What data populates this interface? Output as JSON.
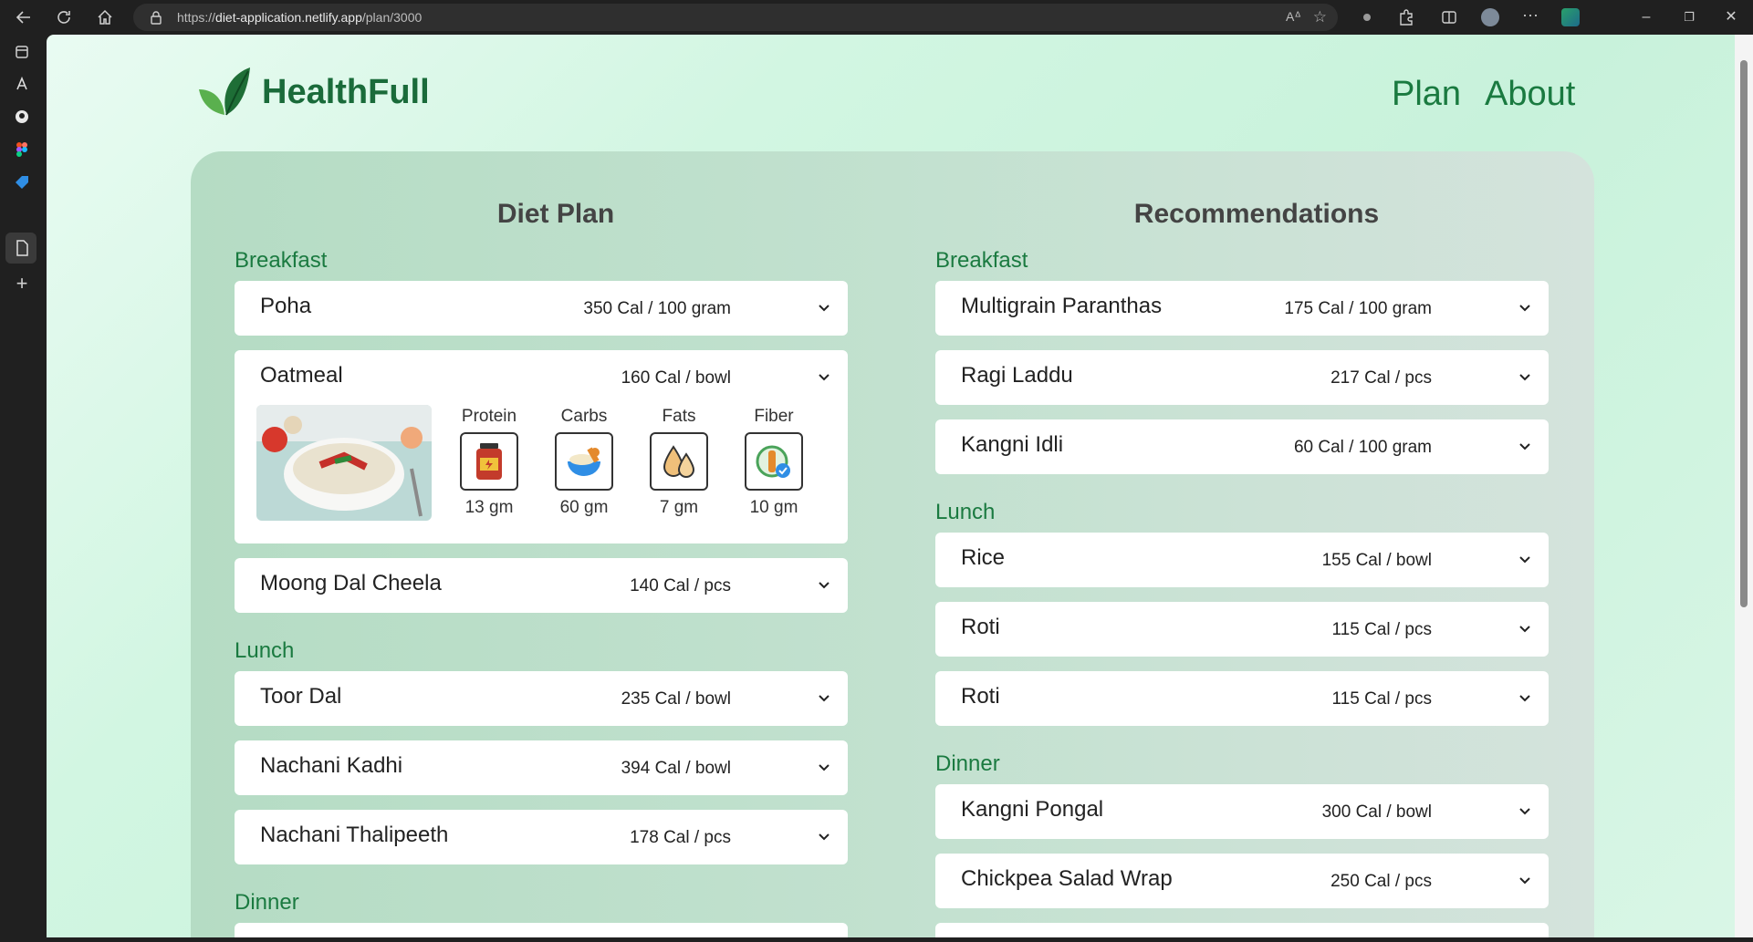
{
  "browser": {
    "url_prefix": "https://",
    "url_host": "diet-application.netlify.app",
    "url_path": "/plan/3000"
  },
  "header": {
    "brand": "HealthFull",
    "nav": [
      "Plan",
      "About"
    ]
  },
  "diet_plan": {
    "title": "Diet Plan",
    "breakfast_label": "Breakfast",
    "lunch_label": "Lunch",
    "dinner_label": "Dinner",
    "breakfast": [
      {
        "name": "Poha",
        "cal": "350 Cal / 100 gram"
      },
      {
        "name": "Oatmeal",
        "cal": "160 Cal / bowl"
      },
      {
        "name": "Moong Dal Cheela",
        "cal": "140 Cal / pcs"
      }
    ],
    "oatmeal_nutrition": [
      {
        "label": "Protein",
        "value": "13 gm"
      },
      {
        "label": "Carbs",
        "value": "60 gm"
      },
      {
        "label": "Fats",
        "value": "7 gm"
      },
      {
        "label": "Fiber",
        "value": "10 gm"
      }
    ],
    "lunch": [
      {
        "name": "Toor Dal",
        "cal": "235 Cal / bowl"
      },
      {
        "name": "Nachani Kadhi",
        "cal": "394 Cal / bowl"
      },
      {
        "name": "Nachani Thalipeeth",
        "cal": "178 Cal / pcs"
      }
    ]
  },
  "recommendations": {
    "title": "Recommendations",
    "breakfast_label": "Breakfast",
    "lunch_label": "Lunch",
    "dinner_label": "Dinner",
    "breakfast": [
      {
        "name": "Multigrain Paranthas",
        "cal": "175 Cal / 100 gram"
      },
      {
        "name": "Ragi Laddu",
        "cal": "217 Cal / pcs"
      },
      {
        "name": "Kangni Idli",
        "cal": "60 Cal / 100 gram"
      }
    ],
    "lunch": [
      {
        "name": "Rice",
        "cal": "155 Cal / bowl"
      },
      {
        "name": "Roti",
        "cal": "115 Cal / pcs"
      },
      {
        "name": "Roti",
        "cal": "115 Cal / pcs"
      }
    ],
    "dinner": [
      {
        "name": "Kangni Pongal",
        "cal": "300 Cal / bowl"
      },
      {
        "name": "Chickpea Salad Wrap",
        "cal": "250 Cal / pcs"
      }
    ]
  },
  "icons": {
    "chevron": "chevron-down-icon",
    "logo": "leaf-logo-icon"
  },
  "colors": {
    "brand_green": "#1a6b3a",
    "label_green": "#1a7a40"
  }
}
